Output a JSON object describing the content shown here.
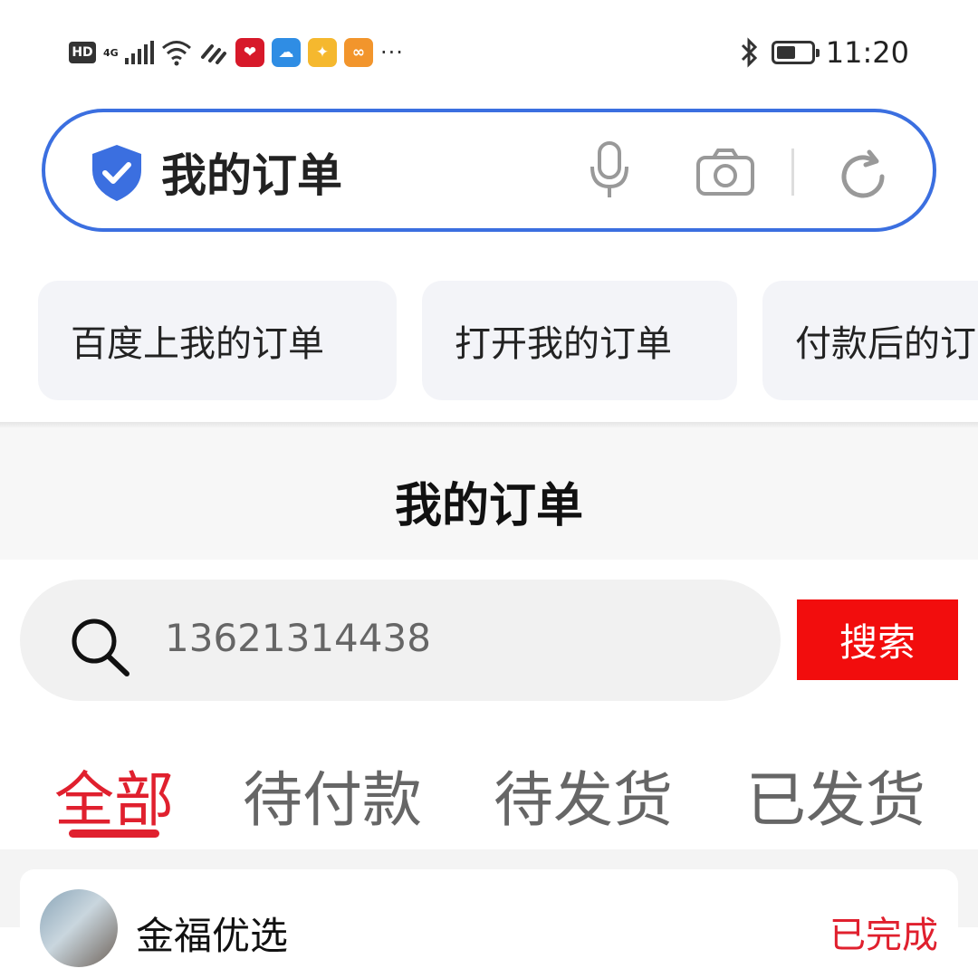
{
  "status_bar": {
    "hd": "HD",
    "network": "4G",
    "app_icons": [
      {
        "name": "heart-app-icon",
        "glyph": "❤",
        "color": "#d7192a"
      },
      {
        "name": "cloud-app-icon",
        "glyph": "☁",
        "color": "#2f8de4"
      },
      {
        "name": "pinwheel-app-icon",
        "glyph": "✦",
        "color": "#3aa0e8"
      },
      {
        "name": "taobao-app-icon",
        "glyph": "∞",
        "color": "#f2952c"
      }
    ],
    "more": "···",
    "time": "11:20",
    "battery_level": 0.55
  },
  "browser": {
    "query": "我的订单",
    "suggestions": [
      "百度上我的订单",
      "打开我的订单",
      "付款后的订单"
    ]
  },
  "page": {
    "title": "我的订单"
  },
  "order_search": {
    "value": "13621314438",
    "button_label": "搜索"
  },
  "tabs": [
    {
      "label": "全部",
      "active": true
    },
    {
      "label": "待付款",
      "active": false
    },
    {
      "label": "待发货",
      "active": false
    },
    {
      "label": "已发货",
      "active": false
    }
  ],
  "orders": [
    {
      "shop": "金福优选",
      "status": "已完成"
    }
  ],
  "colors": {
    "accent_red": "#e0202e",
    "search_button": "#f20d0d",
    "search_border": "#3b6fe0"
  }
}
